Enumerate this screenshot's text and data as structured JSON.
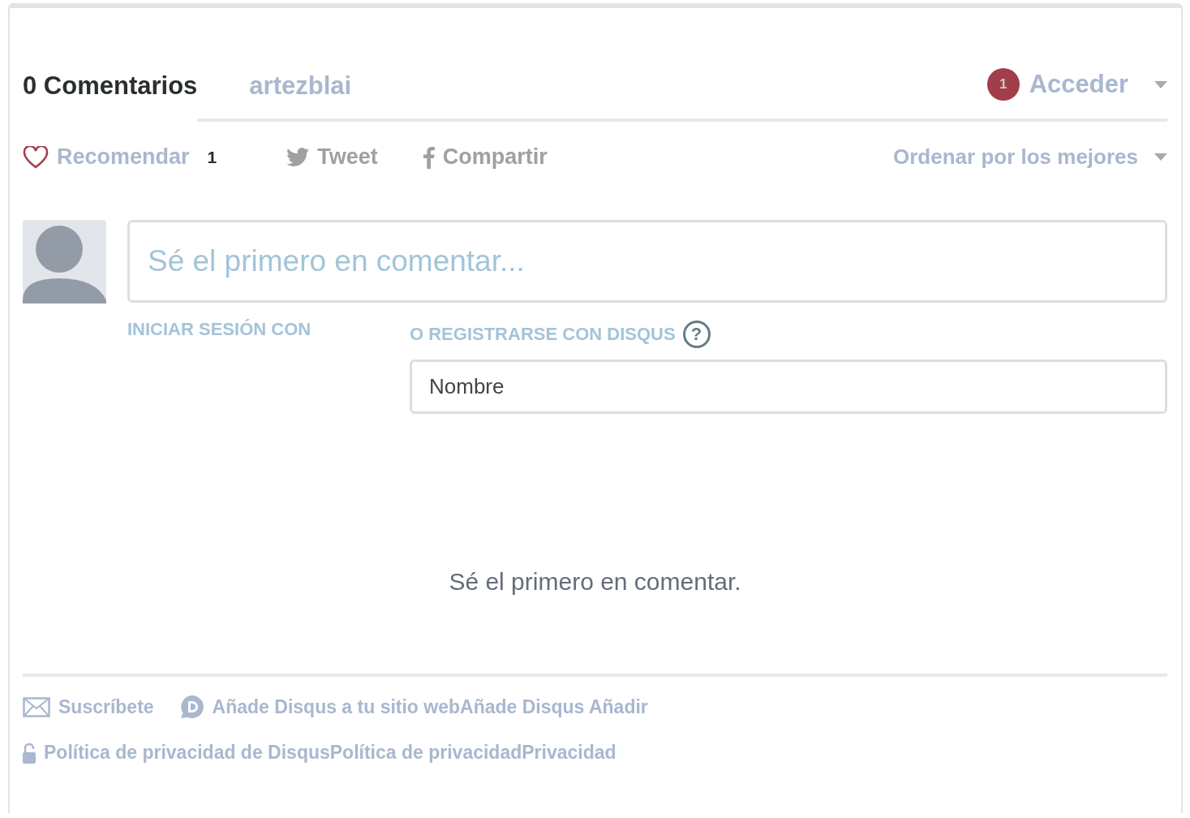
{
  "tabs": [
    {
      "label": "0 Comentarios",
      "selected": true
    },
    {
      "label": "artezblai",
      "selected": false
    }
  ],
  "login": {
    "badge": "1",
    "label": "Acceder"
  },
  "actions": {
    "recommend": "Recomendar",
    "recommend_count": "1",
    "tweet": "Tweet",
    "share": "Compartir",
    "sort": "Ordenar por los mejores"
  },
  "composer": {
    "placeholder": "Sé el primero en comentar...",
    "login_label": "INICIAR SESIÓN CON",
    "register_label": "O REGISTRARSE CON DISQUS",
    "help": "?",
    "name_placeholder": "Nombre"
  },
  "empty_message": "Sé el primero en comentar.",
  "footer": {
    "subscribe": "Suscríbete",
    "add_disqus": "Añade Disqus a tu sitio webAñade Disqus Añadir",
    "privacy": "Política de privacidad de DisqusPolítica de privacidadPrivacidad"
  }
}
